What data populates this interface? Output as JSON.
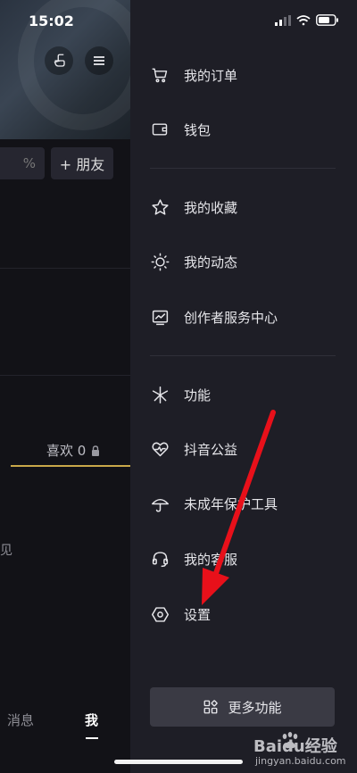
{
  "status_bar": {
    "time": "15:02"
  },
  "background_profile": {
    "search_fragment": "%",
    "add_friend_label": "+ 朋友",
    "likes_tab_label": "喜欢 0",
    "left_fragment_text": "见",
    "nav_messages": "消息",
    "nav_me": "我"
  },
  "drawer": {
    "items": [
      {
        "label": "我的订单",
        "icon": "cart-icon"
      },
      {
        "label": "钱包",
        "icon": "wallet-icon"
      },
      {
        "label": "我的收藏",
        "icon": "star-icon"
      },
      {
        "label": "我的动态",
        "icon": "sun-icon"
      },
      {
        "label": "创作者服务中心",
        "icon": "chart-icon"
      },
      {
        "label": "功能",
        "icon": "sparkle-icon"
      },
      {
        "label": "抖音公益",
        "icon": "heart-pulse-icon"
      },
      {
        "label": "未成年保护工具",
        "icon": "umbrella-icon"
      },
      {
        "label": "我的客服",
        "icon": "headset-icon"
      },
      {
        "label": "设置",
        "icon": "settings-hex-icon"
      }
    ],
    "more_button_label": "更多功能"
  },
  "watermark": {
    "brand": "Baidu经验",
    "site": "jingyan.baidu.com"
  },
  "colors": {
    "drawer_bg": "#1e1e26",
    "annotation_arrow": "#e8101a",
    "accent_underline": "#c9a84a"
  }
}
